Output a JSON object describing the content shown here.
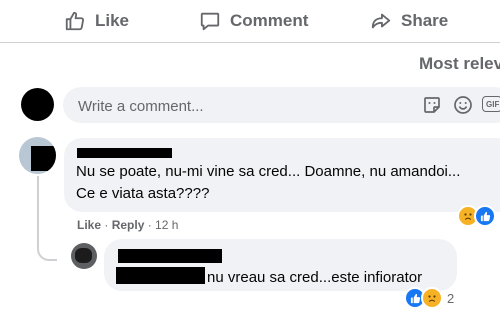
{
  "actions": {
    "like_label": "Like",
    "comment_label": "Comment",
    "share_label": "Share"
  },
  "sort": {
    "label": "Most relev"
  },
  "composer": {
    "placeholder": "Write a comment...",
    "icons": [
      "sticker-icon",
      "emoji-icon",
      "gif-icon"
    ],
    "gif_label": "GIF"
  },
  "comments": [
    {
      "author_redacted": true,
      "text_lines": [
        "Nu se poate, nu-mi vine sa cred... Doamne, nu amandoi...",
        "Ce e viata asta????"
      ],
      "actions": {
        "like": "Like",
        "sep": " · ",
        "reply": "Reply",
        "time": " · 12 h"
      },
      "reactions": [
        "sad",
        "like"
      ],
      "reaction_count": "",
      "reply": {
        "author_redacted": true,
        "text": "nu vreau sa cred...este infiorator",
        "reactions": [
          "like",
          "sad"
        ],
        "reaction_count": "2"
      }
    }
  ],
  "colors": {
    "muted": "#65676b",
    "bubble": "#f0f2f5",
    "like_blue": "#1877f2",
    "sad_yellow": "#f7b125",
    "divider": "#ced0d4"
  }
}
